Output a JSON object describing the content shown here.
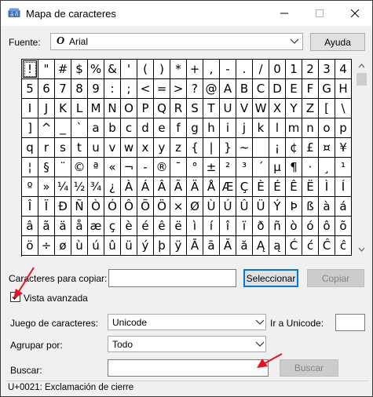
{
  "window": {
    "title": "Mapa de caracteres"
  },
  "font": {
    "label": "Fuente:",
    "icon": "O",
    "value": "Arial",
    "help_button": "Ayuda"
  },
  "grid": {
    "selected_index": 0,
    "rows": [
      [
        "!",
        "\"",
        "#",
        "$",
        "%",
        "&",
        "'",
        "(",
        ")",
        "*",
        "+",
        ",",
        "-",
        ".",
        "/",
        "0",
        "1",
        "2",
        "3",
        "4"
      ],
      [
        "5",
        "6",
        "7",
        "8",
        "9",
        ":",
        ";",
        "<",
        "=",
        ">",
        "?",
        "@",
        "A",
        "B",
        "C",
        "D",
        "E",
        "F",
        "G",
        "H"
      ],
      [
        "I",
        "J",
        "K",
        "L",
        "M",
        "N",
        "O",
        "P",
        "Q",
        "R",
        "S",
        "T",
        "U",
        "V",
        "W",
        "X",
        "Y",
        "Z",
        "[",
        "\\"
      ],
      [
        "]",
        "^",
        "_",
        "`",
        "a",
        "b",
        "c",
        "d",
        "e",
        "f",
        "g",
        "h",
        "i",
        "j",
        "k",
        "l",
        "m",
        "n",
        "o",
        "p"
      ],
      [
        "q",
        "r",
        "s",
        "t",
        "u",
        "v",
        "w",
        "x",
        "y",
        "z",
        "{",
        "|",
        "}",
        "~",
        "",
        "¡",
        "¢",
        "£",
        "¤",
        "¥"
      ],
      [
        "¦",
        "§",
        "¨",
        "©",
        "ª",
        "«",
        "¬",
        "-",
        "®",
        "¯",
        "°",
        "±",
        "²",
        "³",
        "´",
        "µ",
        "¶",
        "·",
        "¸",
        "¹"
      ],
      [
        "º",
        "»",
        "¼",
        "½",
        "¾",
        "¿",
        "À",
        "Á",
        "Â",
        "Ã",
        "Ä",
        "Å",
        "Æ",
        "Ç",
        "È",
        "É",
        "Ê",
        "Ë",
        "Ì",
        "Í"
      ],
      [
        "Î",
        "Ï",
        "Ð",
        "Ñ",
        "Ò",
        "Ó",
        "Ô",
        "Õ",
        "Ö",
        "×",
        "Ø",
        "Ù",
        "Ú",
        "Û",
        "Ü",
        "Ý",
        "Þ",
        "ß",
        "à",
        "á"
      ],
      [
        "â",
        "ã",
        "ä",
        "å",
        "æ",
        "ç",
        "è",
        "é",
        "ê",
        "ë",
        "ì",
        "í",
        "î",
        "ï",
        "ð",
        "ñ",
        "ò",
        "ó",
        "ô",
        "õ"
      ],
      [
        "ö",
        "÷",
        "ø",
        "ù",
        "ú",
        "û",
        "ü",
        "ý",
        "þ",
        "ÿ",
        "Ā",
        "ā",
        "Ă",
        "ă",
        "Ą",
        "ą",
        "Ć",
        "ć",
        "Ĉ",
        "ĉ"
      ]
    ]
  },
  "copy": {
    "label": "Caracteres para copiar:",
    "value": "",
    "select_button": "Seleccionar",
    "copy_button": "Copiar"
  },
  "advanced": {
    "label": "Vista avanzada",
    "checked": true
  },
  "charset": {
    "label": "Juego de caracteres:",
    "value": "Unicode",
    "goto_label": "Ir a Unicode:",
    "goto_value": ""
  },
  "group": {
    "label": "Agrupar por:",
    "value": "Todo"
  },
  "search": {
    "label": "Buscar:",
    "value": "",
    "button": "Buscar"
  },
  "status": {
    "text": "U+0021: Exclamación de cierre"
  },
  "colors": {
    "accent": "#0078d7",
    "annotation": "#e81123"
  }
}
